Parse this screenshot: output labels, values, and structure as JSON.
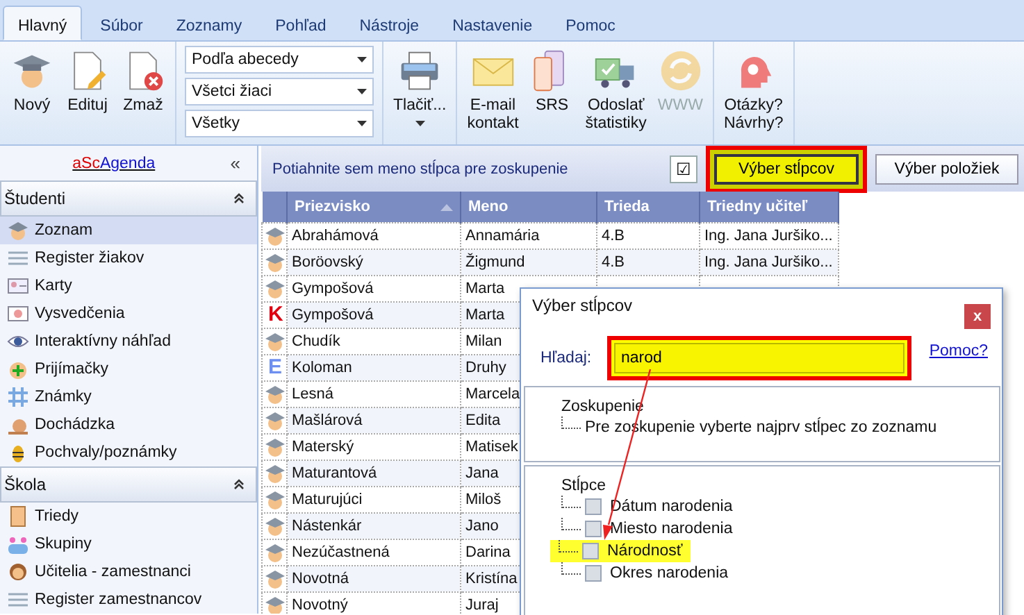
{
  "menu_tabs": [
    {
      "label": "Hlavný",
      "selected": true
    },
    {
      "label": "Súbor",
      "selected": false
    },
    {
      "label": "Zoznamy",
      "selected": false
    },
    {
      "label": "Pohľad",
      "selected": false
    },
    {
      "label": "Nástroje",
      "selected": false
    },
    {
      "label": "Nastavenie",
      "selected": false
    },
    {
      "label": "Pomoc",
      "selected": false
    }
  ],
  "ribbon": [
    {
      "kind": "buttons",
      "items": [
        {
          "lines": [
            "Nový"
          ],
          "disabled": false
        },
        {
          "lines": [
            "Edituj"
          ],
          "disabled": false
        },
        {
          "lines": [
            "Zmaž"
          ],
          "disabled": false
        }
      ]
    },
    {
      "kind": "combos",
      "items": [
        {
          "value": "Podľa abecedy"
        },
        {
          "value": "Všetci žiaci"
        },
        {
          "value": "Všetky"
        }
      ]
    },
    {
      "kind": "buttons",
      "items": [
        {
          "lines": [
            "Tlačiť..."
          ],
          "disabled": false,
          "dropdown": true
        }
      ]
    },
    {
      "kind": "buttons",
      "items": [
        {
          "lines": [
            "E-mail",
            "kontakt"
          ],
          "disabled": false
        },
        {
          "lines": [
            "SRS"
          ],
          "disabled": false
        },
        {
          "lines": [
            "Odoslať",
            "štatistiky"
          ],
          "disabled": false
        },
        {
          "lines": [
            "WWW"
          ],
          "disabled": true
        }
      ]
    },
    {
      "kind": "buttons",
      "items": [
        {
          "lines": [
            "Otázky?",
            "Návrhy?"
          ],
          "disabled": false
        }
      ]
    }
  ],
  "sidebar": {
    "logo": [
      {
        "text": "aSc",
        "color": "#e00000"
      },
      {
        "text": "Agenda",
        "color": "#1010d0"
      }
    ],
    "collapse": "«",
    "sections": [
      {
        "title": "Študenti",
        "expanded": true,
        "items": [
          {
            "label": "Zoznam",
            "selected": true
          },
          {
            "label": "Register žiakov",
            "selected": false
          },
          {
            "label": "Karty",
            "selected": false
          },
          {
            "label": "Vysvedčenia",
            "selected": false
          },
          {
            "label": "Interaktívny náhľad",
            "selected": false
          },
          {
            "label": "Prijímačky",
            "selected": false
          },
          {
            "label": "Známky",
            "selected": false
          },
          {
            "label": "Dochádzka",
            "selected": false
          },
          {
            "label": "Pochvaly/poznámky",
            "selected": false
          }
        ]
      },
      {
        "title": "Škola",
        "expanded": true,
        "items": [
          {
            "label": "Triedy",
            "selected": false
          },
          {
            "label": "Skupiny",
            "selected": false
          },
          {
            "label": "Učitelia - zamestnanci",
            "selected": false
          },
          {
            "label": "Register zamestnancov",
            "selected": false
          }
        ]
      }
    ]
  },
  "grid": {
    "group_hint": "Potiahnite sem meno stĺpca pre zoskupenie",
    "toggle": "☑",
    "buttons": [
      {
        "label": "Výber stĺpcov",
        "highlighted": true
      },
      {
        "label": "Výber položiek",
        "highlighted": false
      }
    ],
    "columns": [
      {
        "label": "Priezvisko",
        "sorted": true
      },
      {
        "label": "Meno",
        "sorted": false
      },
      {
        "label": "Trieda",
        "sorted": false
      },
      {
        "label": "Triedny učiteľ",
        "sorted": false
      }
    ],
    "rows": [
      {
        "cells": [
          "Abrahámová",
          "Annamária",
          "4.B",
          "Ing. Jana Juršiko..."
        ]
      },
      {
        "cells": [
          "Boröovský",
          "Žigmund",
          "4.B",
          "Ing. Jana Juršiko..."
        ]
      },
      {
        "cells": [
          "Gympošová",
          "Marta"
        ]
      },
      {
        "badge": "K",
        "kind": "alert",
        "cells": [
          "Gympošová",
          "Marta"
        ]
      },
      {
        "cells": [
          "Chudík",
          "Milan"
        ]
      },
      {
        "badge": "E",
        "kind": "info",
        "cells": [
          "Koloman",
          "Druhy"
        ]
      },
      {
        "cells": [
          "Lesná",
          "Marcela"
        ]
      },
      {
        "cells": [
          "Mašlárová",
          "Edita"
        ]
      },
      {
        "cells": [
          "Materský",
          "Matisek"
        ]
      },
      {
        "cells": [
          "Maturantová",
          "Jana"
        ]
      },
      {
        "cells": [
          "Maturujúci",
          "Miloš"
        ]
      },
      {
        "cells": [
          "Nástenkár",
          "Jano"
        ]
      },
      {
        "cells": [
          "Nezúčastnená",
          "Darina"
        ]
      },
      {
        "cells": [
          "Novotná",
          "Kristína"
        ]
      },
      {
        "cells": [
          "Novotný",
          "Juraj"
        ]
      }
    ]
  },
  "dialog": {
    "title": "Výber stĺpcov",
    "close": "x",
    "search_label": "Hľadaj:",
    "search_value": "narod",
    "search_highlighted": true,
    "help_link": "Pomoc?",
    "grouping": {
      "title": "Zoskupenie",
      "children": [
        {
          "label": "Pre zoskupenie vyberte najprv stĺpec zo zoznamu"
        }
      ]
    },
    "columns": {
      "title": "Stĺpce",
      "children": [
        {
          "label": "Dátum narodenia",
          "checked": false,
          "highlighted": false
        },
        {
          "label": "Miesto narodenia",
          "checked": false,
          "highlighted": false
        },
        {
          "label": "Národnosť",
          "checked": false,
          "highlighted": true
        },
        {
          "label": "Okres narodenia",
          "checked": false,
          "highlighted": false
        }
      ]
    }
  }
}
